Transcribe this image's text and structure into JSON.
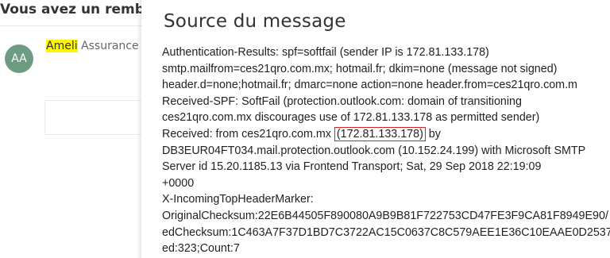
{
  "background": {
    "subject": "Vous avez un rembo",
    "avatar_initials": "AA",
    "sender_highlight": "Ameli",
    "sender_rest": " Assurance"
  },
  "modal": {
    "title": "Source du message",
    "lines": [
      "Authentication-Results: spf=softfail (sender IP is 172.81.133.178)",
      "smtp.mailfrom=ces21qro.com.mx; hotmail.fr; dkim=none (message not signed)",
      "header.d=none;hotmail.fr; dmarc=none action=none header.from=ces21qro.com.m",
      "Received-SPF: SoftFail (protection.outlook.com: domain of transitioning",
      "ces21qro.com.mx discourages use of 172.81.133.178 as permitted sender)"
    ],
    "received_line": {
      "prefix": "Received: from ces21qro.com.mx ",
      "ip_boxed": "(172.81.133.178)",
      "suffix": " by"
    },
    "lines_after": [
      "DB3EUR04FT034.mail.protection.outlook.com (10.152.24.199) with Microsoft SMTP",
      "Server id 15.20.1185.13 via Frontend Transport; Sat, 29 Sep 2018 22:19:09",
      "+0000",
      "X-IncomingTopHeaderMarker:",
      "OriginalChecksum:22E6B44505F890080A9B9B81F722753CD47FE3F9CA81F8949E90/",
      "edChecksum:1C463A7F37D1BD7C3722AC15C0637C8C579AEE1E36C10EAAE0D2537",
      "ed:323;Count:7"
    ]
  },
  "colors": {
    "highlight": "#fff700",
    "ip_box": "#d42222",
    "avatar": "#6e9c83"
  }
}
